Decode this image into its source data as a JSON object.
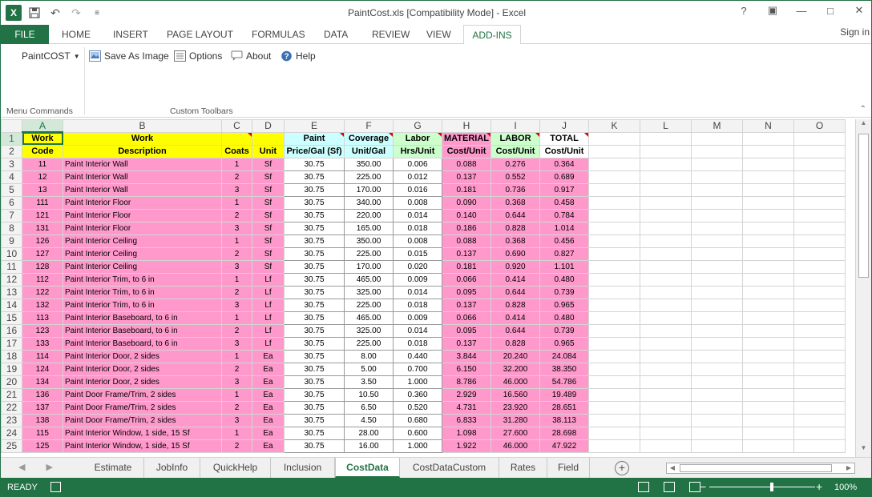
{
  "window": {
    "title": "PaintCost.xls  [Compatibility Mode] - Excel",
    "app_logo": "X",
    "controls": [
      "?",
      "▣",
      "—",
      "□",
      "✕"
    ]
  },
  "ribbon_tabs": [
    {
      "label": "FILE"
    },
    {
      "label": "HOME"
    },
    {
      "label": "INSERT"
    },
    {
      "label": "PAGE LAYOUT"
    },
    {
      "label": "FORMULAS"
    },
    {
      "label": "DATA"
    },
    {
      "label": "REVIEW"
    },
    {
      "label": "VIEW"
    },
    {
      "label": "ADD-INS"
    }
  ],
  "signin": "Sign in",
  "ribbon": {
    "paintcost_menu": "PaintCOST",
    "save_as_image": "Save As Image",
    "options": "Options",
    "about": "About",
    "help": "Help",
    "group_menu_commands": "Menu Commands",
    "group_custom_toolbars": "Custom Toolbars"
  },
  "columns": [
    "A",
    "B",
    "C",
    "D",
    "E",
    "F",
    "G",
    "H",
    "I",
    "J",
    "K",
    "L",
    "M",
    "N",
    "O"
  ],
  "header_row1": [
    "Work",
    "Work",
    "",
    "",
    "Paint",
    "Coverage",
    "Labor",
    "MATERIAL",
    "LABOR",
    "TOTAL"
  ],
  "header_row2": [
    "Code",
    "Description",
    "Coats",
    "Unit",
    "Price/Gal (Sf)",
    "Unit/Gal",
    "Hrs/Unit",
    "Cost/Unit",
    "Cost/Unit",
    "Cost/Unit"
  ],
  "rows": [
    {
      "n": "3",
      "cells": [
        "11",
        "Paint Interior Wall",
        "1",
        "Sf",
        "30.75",
        "350.00",
        "0.006",
        "0.088",
        "0.276",
        "0.364"
      ]
    },
    {
      "n": "4",
      "cells": [
        "12",
        "Paint Interior Wall",
        "2",
        "Sf",
        "30.75",
        "225.00",
        "0.012",
        "0.137",
        "0.552",
        "0.689"
      ]
    },
    {
      "n": "5",
      "cells": [
        "13",
        "Paint Interior Wall",
        "3",
        "Sf",
        "30.75",
        "170.00",
        "0.016",
        "0.181",
        "0.736",
        "0.917"
      ]
    },
    {
      "n": "6",
      "cells": [
        "111",
        "Paint Interior Floor",
        "1",
        "Sf",
        "30.75",
        "340.00",
        "0.008",
        "0.090",
        "0.368",
        "0.458"
      ]
    },
    {
      "n": "7",
      "cells": [
        "121",
        "Paint Interior Floor",
        "2",
        "Sf",
        "30.75",
        "220.00",
        "0.014",
        "0.140",
        "0.644",
        "0.784"
      ]
    },
    {
      "n": "8",
      "cells": [
        "131",
        "Paint Interior Floor",
        "3",
        "Sf",
        "30.75",
        "165.00",
        "0.018",
        "0.186",
        "0.828",
        "1.014"
      ]
    },
    {
      "n": "9",
      "cells": [
        "126",
        "Paint Interior Ceiling",
        "1",
        "Sf",
        "30.75",
        "350.00",
        "0.008",
        "0.088",
        "0.368",
        "0.456"
      ]
    },
    {
      "n": "10",
      "cells": [
        "127",
        "Paint Interior Ceiling",
        "2",
        "Sf",
        "30.75",
        "225.00",
        "0.015",
        "0.137",
        "0.690",
        "0.827"
      ]
    },
    {
      "n": "11",
      "cells": [
        "128",
        "Paint Interior Ceiling",
        "3",
        "Sf",
        "30.75",
        "170.00",
        "0.020",
        "0.181",
        "0.920",
        "1.101"
      ]
    },
    {
      "n": "12",
      "cells": [
        "112",
        "Paint Interior Trim, to 6 in",
        "1",
        "Lf",
        "30.75",
        "465.00",
        "0.009",
        "0.066",
        "0.414",
        "0.480"
      ]
    },
    {
      "n": "13",
      "cells": [
        "122",
        "Paint Interior Trim, to 6 in",
        "2",
        "Lf",
        "30.75",
        "325.00",
        "0.014",
        "0.095",
        "0.644",
        "0.739"
      ]
    },
    {
      "n": "14",
      "cells": [
        "132",
        "Paint Interior Trim, to 6 in",
        "3",
        "Lf",
        "30.75",
        "225.00",
        "0.018",
        "0.137",
        "0.828",
        "0.965"
      ]
    },
    {
      "n": "15",
      "cells": [
        "113",
        "Paint Interior Baseboard, to 6 in",
        "1",
        "Lf",
        "30.75",
        "465.00",
        "0.009",
        "0.066",
        "0.414",
        "0.480"
      ]
    },
    {
      "n": "16",
      "cells": [
        "123",
        "Paint Interior Baseboard, to 6 in",
        "2",
        "Lf",
        "30.75",
        "325.00",
        "0.014",
        "0.095",
        "0.644",
        "0.739"
      ]
    },
    {
      "n": "17",
      "cells": [
        "133",
        "Paint Interior Baseboard, to 6 in",
        "3",
        "Lf",
        "30.75",
        "225.00",
        "0.018",
        "0.137",
        "0.828",
        "0.965"
      ]
    },
    {
      "n": "18",
      "cells": [
        "114",
        "Paint Interior Door, 2 sides",
        "1",
        "Ea",
        "30.75",
        "8.00",
        "0.440",
        "3.844",
        "20.240",
        "24.084"
      ]
    },
    {
      "n": "19",
      "cells": [
        "124",
        "Paint Interior Door, 2 sides",
        "2",
        "Ea",
        "30.75",
        "5.00",
        "0.700",
        "6.150",
        "32.200",
        "38.350"
      ]
    },
    {
      "n": "20",
      "cells": [
        "134",
        "Paint Interior Door, 2 sides",
        "3",
        "Ea",
        "30.75",
        "3.50",
        "1.000",
        "8.786",
        "46.000",
        "54.786"
      ]
    },
    {
      "n": "21",
      "cells": [
        "136",
        "Paint Door Frame/Trim, 2 sides",
        "1",
        "Ea",
        "30.75",
        "10.50",
        "0.360",
        "2.929",
        "16.560",
        "19.489"
      ]
    },
    {
      "n": "22",
      "cells": [
        "137",
        "Paint Door Frame/Trim, 2 sides",
        "2",
        "Ea",
        "30.75",
        "6.50",
        "0.520",
        "4.731",
        "23.920",
        "28.651"
      ]
    },
    {
      "n": "23",
      "cells": [
        "138",
        "Paint Door Frame/Trim, 2 sides",
        "3",
        "Ea",
        "30.75",
        "4.50",
        "0.680",
        "6.833",
        "31.280",
        "38.113"
      ]
    },
    {
      "n": "24",
      "cells": [
        "115",
        "Paint Interior Window, 1 side, 15 Sf",
        "1",
        "Ea",
        "30.75",
        "28.00",
        "0.600",
        "1.098",
        "27.600",
        "28.698"
      ]
    },
    {
      "n": "25",
      "cells": [
        "125",
        "Paint Interior Window, 1 side, 15 Sf",
        "2",
        "Ea",
        "30.75",
        "16.00",
        "1.000",
        "1.922",
        "46.000",
        "47.922"
      ]
    }
  ],
  "sheet_tabs": [
    {
      "label": "Estimate"
    },
    {
      "label": "JobInfo"
    },
    {
      "label": "QuickHelp"
    },
    {
      "label": "Inclusion"
    },
    {
      "label": "CostData",
      "active": true
    },
    {
      "label": "CostDataCustom"
    },
    {
      "label": "Rates"
    },
    {
      "label": "Field"
    }
  ],
  "status": {
    "mode": "READY",
    "zoom": "100%"
  }
}
